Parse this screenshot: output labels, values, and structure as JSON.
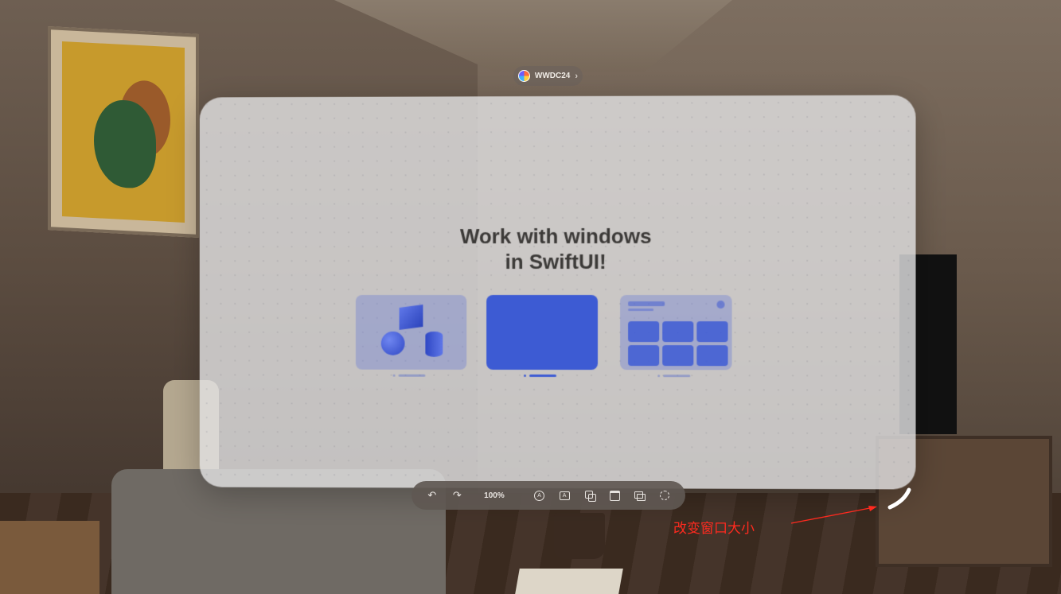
{
  "app_chip": {
    "label": "WWDC24",
    "chevron": "›"
  },
  "window": {
    "headline": "Work with windows\nin SwiftUI!",
    "cards": [
      {
        "name": "volume-shapes",
        "selected": false
      },
      {
        "name": "plain-window",
        "selected": true
      },
      {
        "name": "dashboard-grid",
        "selected": false
      }
    ]
  },
  "toolbar": {
    "undo_icon": "↶",
    "redo_icon": "↷",
    "zoom_level": "100%",
    "text_circle_glyph": "A",
    "text_box_glyph": "A",
    "icons": [
      "undo-icon",
      "redo-icon",
      "markup-pen-icon",
      "text-box-icon",
      "duplicate-icon",
      "window-icon",
      "photos-icon",
      "lasso-icon"
    ]
  },
  "annotation": {
    "label": "改变窗口大小",
    "color": "#ff2a1f"
  },
  "colors": {
    "accent": "#3d5bd3",
    "glass": "#e2e2e4",
    "toolbar": "#5f5852"
  }
}
